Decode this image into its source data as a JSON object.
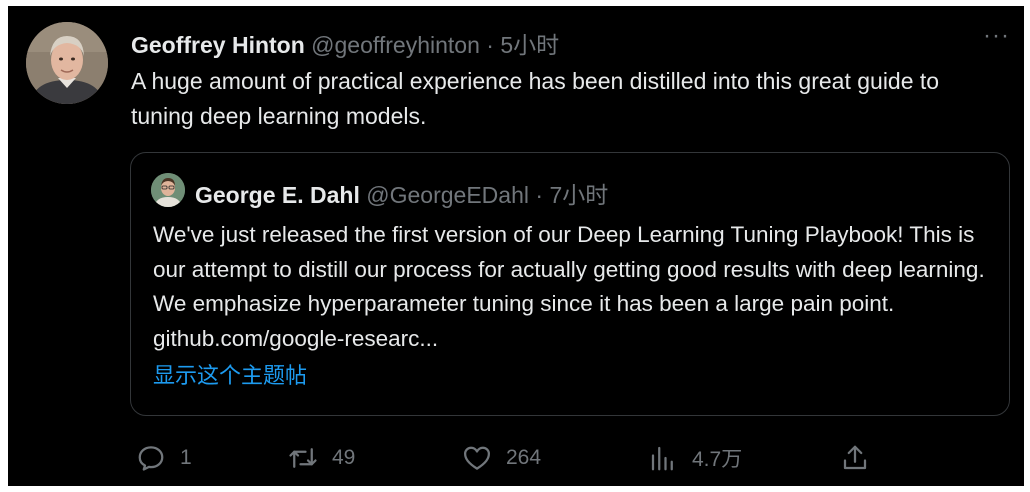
{
  "tweet": {
    "author_name": "Geoffrey Hinton",
    "author_handle": "@geoffreyhinton",
    "separator": "·",
    "time": "5小时",
    "more_label": "···",
    "text": "A huge amount of practical experience has been distilled into this great guide to tuning deep learning models."
  },
  "quote": {
    "author_name": "George E. Dahl",
    "author_handle": "@GeorgeEDahl",
    "separator": "·",
    "time": "7小时",
    "text": "We've just released the first version of our Deep Learning Tuning Playbook! This is our attempt to distill our process for actually getting good results with deep learning. We emphasize hyperparameter tuning since it has been a large pain point. github.com/google-researc...",
    "show_thread": "显示这个主题帖"
  },
  "actions": {
    "reply_count": "1",
    "retweet_count": "49",
    "like_count": "264",
    "views_count": "4.7万"
  },
  "icons": {
    "reply": "reply-icon",
    "retweet": "retweet-icon",
    "like": "heart-icon",
    "views": "views-chart-icon",
    "share": "share-icon",
    "more": "more-horizontal-icon"
  },
  "colors": {
    "background": "#000000",
    "text": "#e7e9ea",
    "muted": "#71767b",
    "link": "#1d9bf0",
    "border": "#333639"
  }
}
